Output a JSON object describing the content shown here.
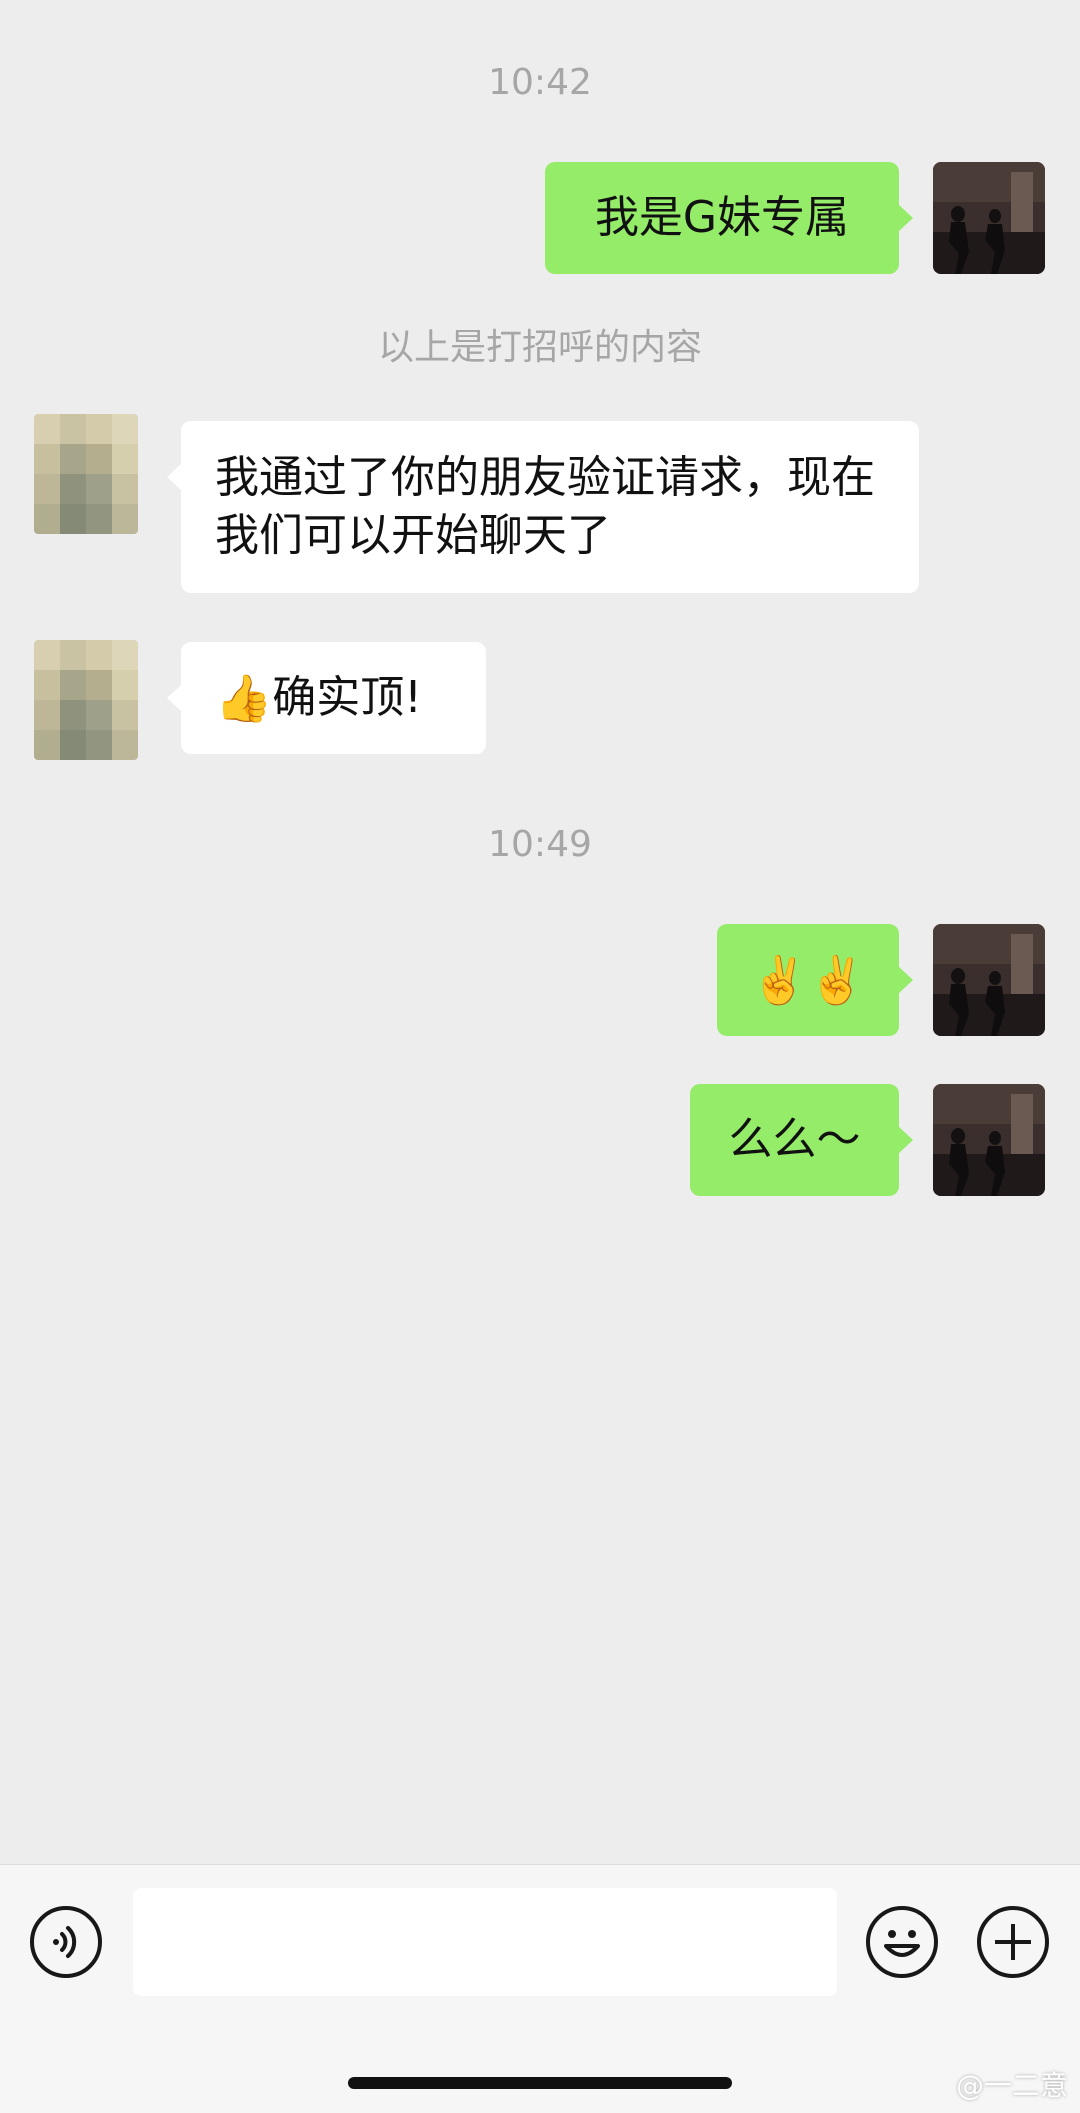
{
  "chat": {
    "time_1": "10:42",
    "msg_out_1": "我是G妹专属",
    "system_note": "以上是打招呼的内容",
    "msg_in_1": "我通过了你的朋友验证请求，现在我们可以开始聊天了",
    "msg_in_2": {
      "emoji": "👍",
      "text": "确实顶!"
    },
    "time_2": "10:49",
    "msg_out_2": "✌️✌️",
    "msg_out_3": "么么～"
  },
  "input_bar": {
    "voice_icon": "voice-icon",
    "emoji_icon": "smiley-icon",
    "more_icon": "plus-icon",
    "text_value": ""
  },
  "watermark": "@一二意",
  "colors": {
    "out_bubble": "#95ec69",
    "in_bubble": "#ffffff",
    "background": "#ededed"
  }
}
